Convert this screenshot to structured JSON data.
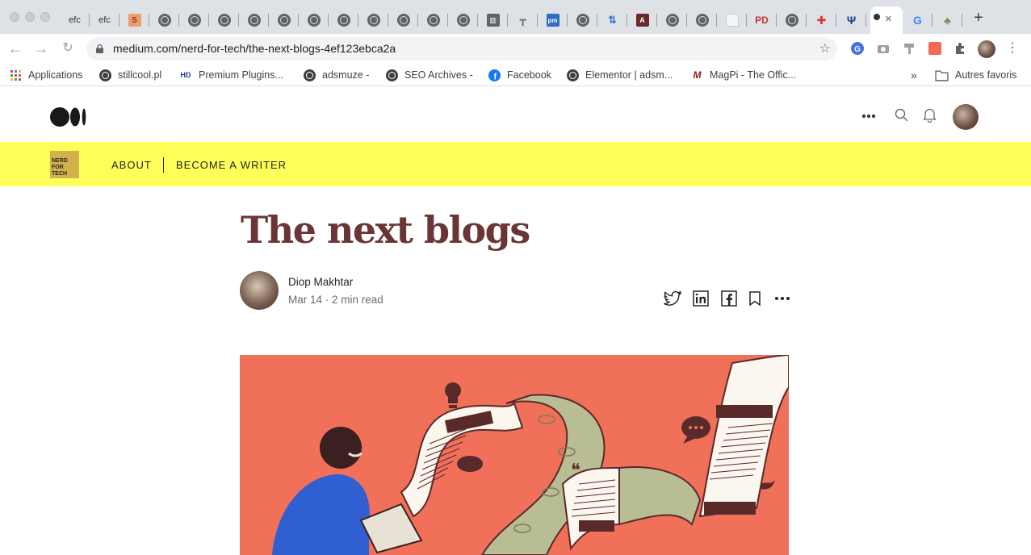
{
  "browser": {
    "tabs": [
      {
        "favicon": "efc-text",
        "label": "efc"
      },
      {
        "favicon": "efc-text",
        "label": "efc"
      },
      {
        "favicon": "s-orange-logo"
      },
      {
        "favicon": "globe-icon"
      },
      {
        "favicon": "globe-icon"
      },
      {
        "favicon": "globe-icon"
      },
      {
        "favicon": "globe-icon"
      },
      {
        "favicon": "globe-icon"
      },
      {
        "favicon": "globe-icon"
      },
      {
        "favicon": "globe-icon"
      },
      {
        "favicon": "globe-icon"
      },
      {
        "favicon": "globe-icon"
      },
      {
        "favicon": "trash-icon"
      },
      {
        "favicon": "pin-icon"
      },
      {
        "favicon": "blue-logo"
      },
      {
        "favicon": "globe-icon"
      },
      {
        "favicon": "blue-arrows-logo"
      },
      {
        "favicon": "dark-red-logo"
      },
      {
        "favicon": "globe-icon"
      },
      {
        "favicon": "globe-icon"
      },
      {
        "favicon": "white-logo"
      },
      {
        "favicon": "pd-logo",
        "label": "PD"
      },
      {
        "favicon": "globe-icon"
      },
      {
        "favicon": "red-cross-logo"
      },
      {
        "favicon": "trident-logo"
      },
      {
        "favicon": "medium-logo",
        "active": true,
        "close_label": "×"
      },
      {
        "favicon": "google-logo",
        "label": "G"
      },
      {
        "favicon": "tree-logo"
      }
    ],
    "new_tab_label": "+",
    "url": "medium.com/nerd-for-tech/the-next-blogs-4ef123ebca2a",
    "bookmarks": [
      {
        "icon": "apps-grid-icon",
        "label": "Applications"
      },
      {
        "icon": "globe-icon",
        "label": "stillcool.pl"
      },
      {
        "icon": "hd-logo",
        "label": "Premium Plugins..."
      },
      {
        "icon": "globe-icon",
        "label": "adsmuze -"
      },
      {
        "icon": "globe-icon",
        "label": "SEO Archives -"
      },
      {
        "icon": "facebook-icon",
        "label": "Facebook"
      },
      {
        "icon": "globe-icon",
        "label": "Elementor | adsm..."
      },
      {
        "icon": "magpi-logo",
        "label": "MagPi - The Offic..."
      }
    ],
    "bookmarks_overflow": "»",
    "other_bookmarks": "Autres favoris",
    "colors": {
      "chrome_bg": "#dee1e6",
      "omnibox_bg": "#f1f3f4"
    }
  },
  "medium": {
    "publication_nav": {
      "about": "ABOUT",
      "become_writer": "BECOME A WRITER",
      "logo_text": "NERD FOR TECH"
    },
    "article": {
      "title": "The next blogs",
      "author": "Diop Makhtar",
      "meta": "Mar 14 · 2 min read"
    },
    "colors": {
      "pub_bar": "#ffff5a",
      "title": "#6b3535",
      "hero_bg": "#f0705a"
    }
  }
}
